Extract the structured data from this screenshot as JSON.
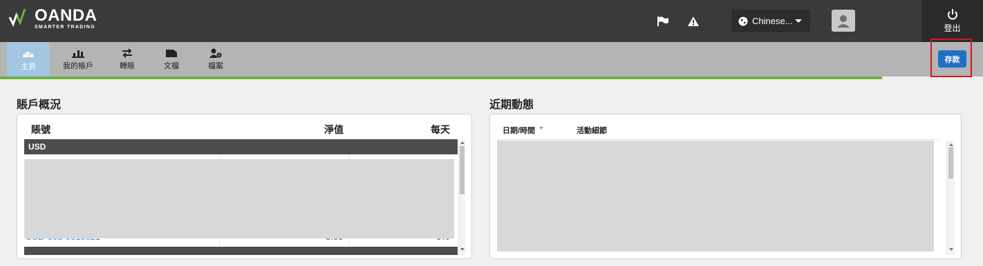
{
  "brand": {
    "name": "OANDA",
    "tagline": "SMARTER TRADING",
    "accent_color": "#6cb33f"
  },
  "header": {
    "icons": [
      "flag-icon",
      "warning-icon"
    ],
    "language": "Chinese...",
    "logout_label": "登出"
  },
  "nav": {
    "items": [
      {
        "label": "主頁",
        "icon": "dashboard-icon",
        "active": true
      },
      {
        "label": "我的帳戶",
        "icon": "bar-chart-icon",
        "active": false
      },
      {
        "label": "轉賬",
        "icon": "transfer-icon",
        "active": false
      },
      {
        "label": "文檔",
        "icon": "folder-icon",
        "active": false
      },
      {
        "label": "檔案",
        "icon": "user-info-icon",
        "active": false
      }
    ],
    "deposit_label": "存款"
  },
  "account_overview": {
    "title": "賬戶概況",
    "columns": [
      "賬號",
      "淨值",
      "每天"
    ],
    "groups": [
      "USD"
    ],
    "partial_account": "USD-003-0010021",
    "partial_value": "0.00",
    "partial_pct": "0%"
  },
  "recent_activity": {
    "title": "近期動態",
    "columns": [
      "日期/時間",
      "活動細節"
    ]
  }
}
